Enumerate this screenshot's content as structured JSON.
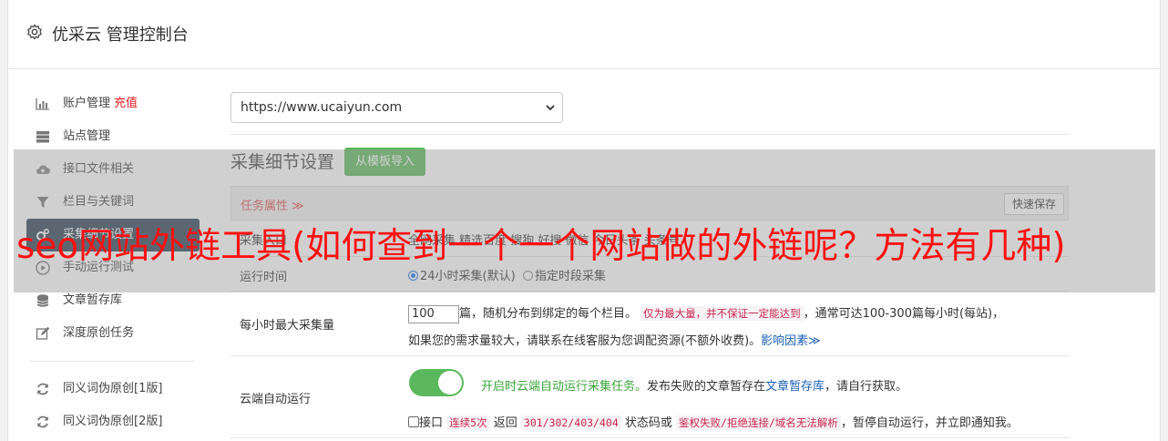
{
  "header": {
    "title": "优采云 管理控制台",
    "icon": "gear-icon"
  },
  "sidebar": {
    "items": [
      {
        "label": "账户管理",
        "extra": "充值",
        "icon": "bar-chart-icon"
      },
      {
        "label": "站点管理",
        "icon": "server-icon"
      },
      {
        "label": "接口文件相关",
        "icon": "cloud-upload-icon"
      },
      {
        "label": "栏目与关键词",
        "icon": "filter-icon"
      },
      {
        "label": "采集细节设置",
        "icon": "gears-icon"
      },
      {
        "label": "手动运行测试",
        "icon": "play-icon"
      },
      {
        "label": "文章暂存库",
        "icon": "database-icon"
      },
      {
        "label": "深度原创任务",
        "icon": "edit-icon"
      },
      {
        "label": "同义词伪原创[1版]",
        "icon": "refresh-icon"
      },
      {
        "label": "同义词伪原创[2版]",
        "icon": "refresh-icon"
      }
    ]
  },
  "main": {
    "site_select": {
      "value": "https://www.ucaiyun.com"
    },
    "section_title": "采集细节设置",
    "template_button": "从模板导入",
    "task_attr": {
      "label": "任务属性 ≫",
      "save_button": "快速保存"
    },
    "entry_row": {
      "label": "采集入口",
      "value": "全网采集 精选百度 搜狗 好搜 微信 今日头条 头条号"
    },
    "run_time": {
      "label": "运行时间",
      "option1": "24小时采集(默认)",
      "option2": "指定时段采集"
    },
    "max_per_hour": {
      "label": "每小时最大采集量",
      "input_value": "100",
      "text1": "篇，随机分布到绑定的每个栏目。",
      "note": "仅为最大量，并不保证一定能达到",
      "text2": "，通常可达100-300篇每小时(每站)，",
      "text3": "如果您的需求量较大，请联系在线客服为您调配资源(不额外收费)。",
      "link": "影响因素≫"
    },
    "cloud_run": {
      "label": "云端自动运行",
      "green": "开启时云端自动运行采集任务。",
      "text1": "发布失败的文章暂存在",
      "link": "文章暂存库",
      "text2": "，请自行获取。",
      "cb_label": "接口",
      "code1": "连续5次",
      "text3": "返回",
      "code2": "301/302/403/404",
      "text4": "状态码或",
      "code3": "鉴权失败/拒绝连接/域名无法解析",
      "text5": "，暂停自动运行，并立即通知我。"
    }
  },
  "overlay": {
    "title": "seo网站外链工具(如何查到一个一个网站做的外链呢？方法有几种)"
  },
  "colors": {
    "accent": "#5cb85c",
    "active_nav": "#2c3e50",
    "red": "#e02020"
  }
}
